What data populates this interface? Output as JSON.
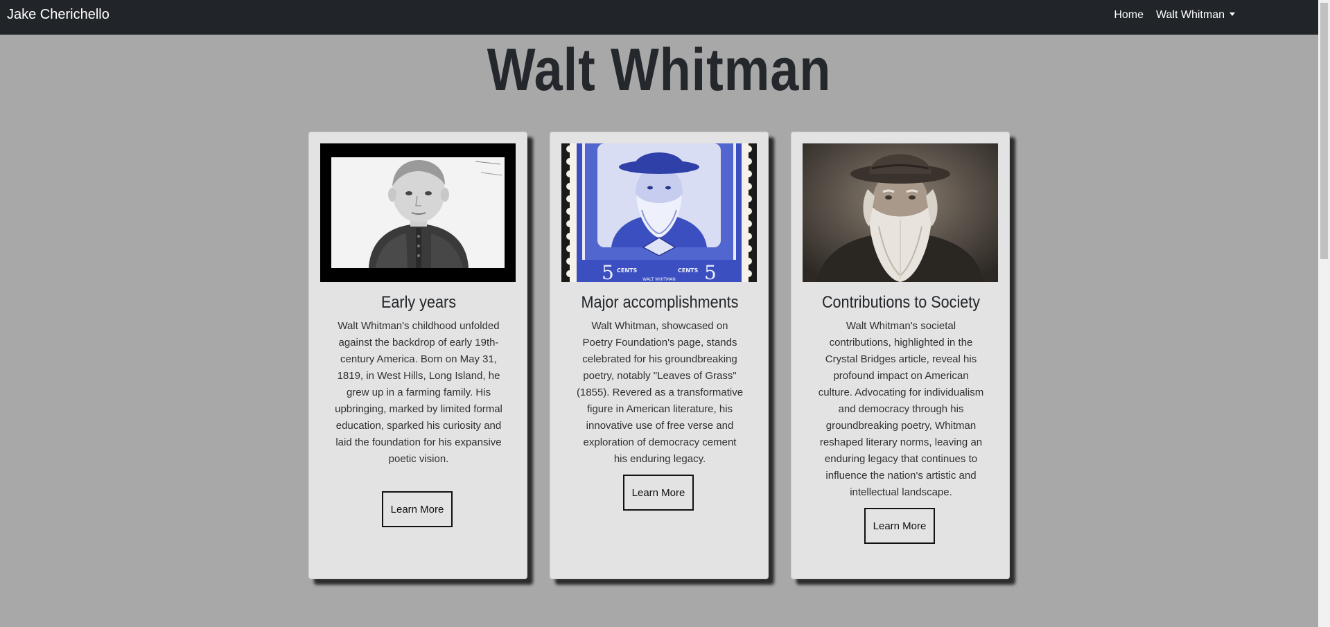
{
  "navbar": {
    "brand": "Jake Cherichello",
    "links": [
      {
        "label": "Home"
      },
      {
        "label": "Walt Whitman",
        "dropdown": true
      }
    ]
  },
  "page": {
    "title": "Walt Whitman"
  },
  "cards": [
    {
      "title": "Early years",
      "image": "childhood-portrait-image",
      "text": "Walt Whitman's childhood unfolded against the backdrop of early 19th-century America. Born on May 31, 1819, in West Hills, Long Island, he grew up in a farming family. His upbringing, marked by limited formal education, sparked his curiosity and laid the foundation for his expansive poetic vision.",
      "button": "Learn More"
    },
    {
      "title": "Major accomplishments",
      "image": "postage-stamp-image",
      "stamp": {
        "value_left": "5",
        "cents_left": "CENTS",
        "cents_right": "CENTS",
        "value_right": "5",
        "name": "WALT WHITMAN"
      },
      "text": "Walt Whitman, showcased on Poetry Foundation's page, stands celebrated for his groundbreaking poetry, notably \"Leaves of Grass\" (1855). Revered as a transformative figure in American literature, his innovative use of free verse and exploration of democracy cement his enduring legacy.",
      "button": "Learn More"
    },
    {
      "title": "Contributions to Society",
      "image": "elder-portrait-image",
      "text": "Walt Whitman's societal contributions, highlighted in the Crystal Bridges article, reveal his profound impact on American culture. Advocating for individualism and democracy through his groundbreaking poetry, Whitman reshaped literary norms, leaving an enduring legacy that continues to influence the nation's artistic and intellectual landscape.",
      "button": "Learn More"
    }
  ],
  "colors": {
    "navbar_bg": "#212529",
    "page_bg": "#a8a8a8",
    "card_bg": "#e3e3e3",
    "stamp_blue": "#3b4fc0"
  }
}
